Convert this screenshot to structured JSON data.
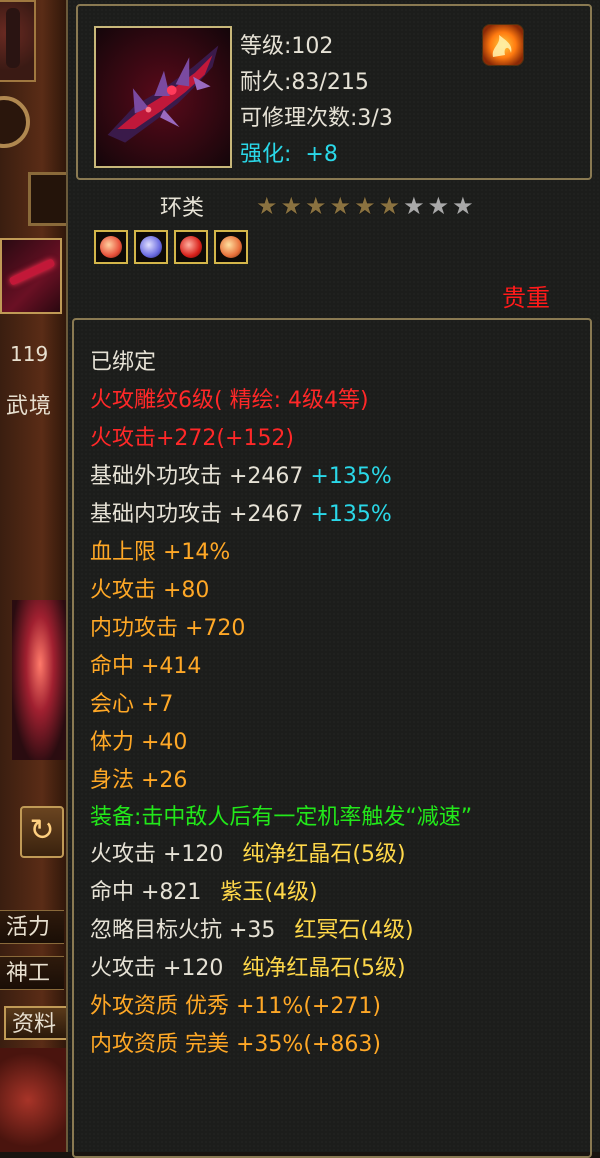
{
  "left_strip": {
    "level_number": "119",
    "realm_text": "武境",
    "tabs": [
      "活力",
      "神工",
      "资料"
    ]
  },
  "item": {
    "level": "等级:102",
    "durability": "耐久:83/215",
    "repair_count": "可修理次数:3/3",
    "enhance_label": "强化:",
    "enhance_value": "+8",
    "category": "环类",
    "stars_filled": 6,
    "stars_total": 9,
    "rarity": "贵重",
    "icon": "crimson-spiked-ring-weapon",
    "gems": [
      {
        "name": "green-gem-icon",
        "color": "#e86a3a"
      },
      {
        "name": "blue-gem-icon",
        "color": "#7a7ae0"
      },
      {
        "name": "red-gem-icon",
        "color": "#d8301a"
      },
      {
        "name": "green-gem-icon",
        "color": "#e87a3a"
      }
    ]
  },
  "attributes": {
    "bound": "已绑定",
    "engrave": "火攻雕纹6级( 精绘: 4级4等)",
    "fire_attack_main": "火攻击+272(+152)",
    "base_outer": "基础外功攻击 +2467",
    "base_outer_pct": "+135%",
    "base_inner": "基础内功攻击 +2467",
    "base_inner_pct": "+135%",
    "hp_limit": "血上限 +14%",
    "fire_attack": "火攻击 +80",
    "inner_attack": "内功攻击 +720",
    "hit": "命中 +414",
    "crit": "会心 +7",
    "stamina": "体力 +40",
    "agility": "身法 +26",
    "equip_effect": "装备:击中敌人后有一定机率触发“减速”",
    "gem_lines": [
      {
        "stat": "火攻击 +120",
        "gem": "纯净红晶石(5级)"
      },
      {
        "stat": "命中 +821",
        "gem": "紫玉(4级)"
      },
      {
        "stat": "忽略目标火抗 +35",
        "gem": "红冥石(4级)"
      },
      {
        "stat": "火攻击 +120",
        "gem": "纯净红晶石(5级)"
      }
    ],
    "aptitude_outer": "外攻资质  优秀 +11%(+271)",
    "aptitude_inner": "内攻资质  完美 +35%(+863)"
  },
  "colors": {
    "white": "#e6e2d6",
    "red": "#ff2828",
    "orange": "#ffa826",
    "green": "#22e81a",
    "cyan": "#2ad8e8",
    "rarity": "#ff1a1a"
  }
}
